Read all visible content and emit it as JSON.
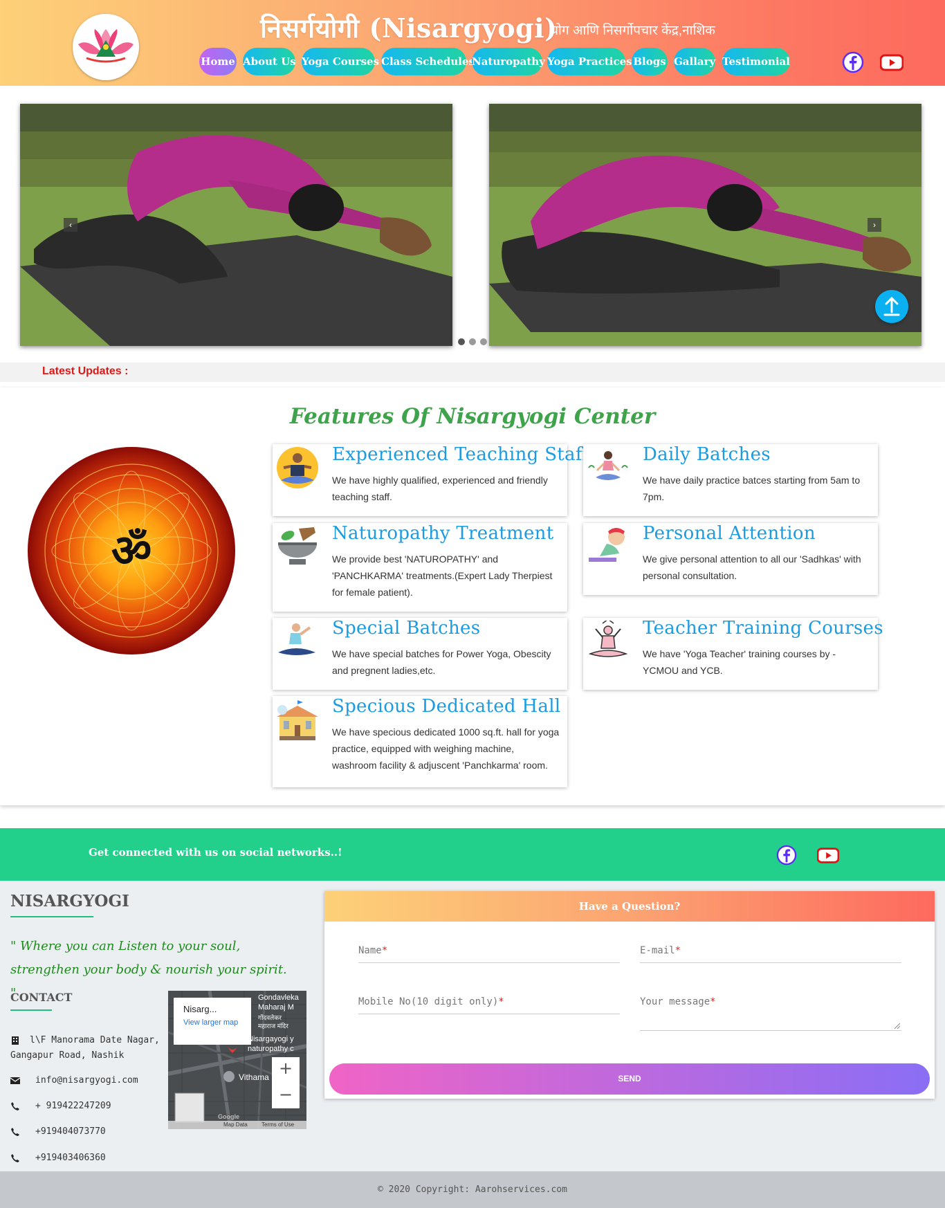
{
  "header": {
    "site_title": "निसर्गयोगी (Nisargyogi)",
    "site_subtitle": "योग आणि निसर्गोपचार केंद्र,नाशिक",
    "nav": [
      "Home",
      "About Us",
      "Yoga Courses",
      "Class Schedules",
      "Naturopathy",
      "Yoga Practices",
      "Blogs",
      "Gallary",
      "Testimonial"
    ],
    "social": [
      "facebook-icon",
      "youtube-icon"
    ]
  },
  "slider": {
    "prev_arrow": "‹",
    "next_arrow": "›",
    "dots": 3,
    "active_dot": 1
  },
  "updates": {
    "label": "Latest Updates :"
  },
  "features": {
    "title": "Features Of Nisargyogi Center",
    "cards": [
      {
        "title": "Experienced Teaching Staff",
        "text": "We have highly qualified, experienced and friendly teaching staff.",
        "icon": "meditating-man-icon"
      },
      {
        "title": "Daily Batches",
        "text": "We have daily practice batces starting from 5am to 7pm.",
        "icon": "meditating-woman-icon"
      },
      {
        "title": "Naturopathy Treatment",
        "text": "We provide best 'NATUROPATHY' and 'PANCHKARMA' treatments.(Expert Lady Therpiest for female patient).",
        "icon": "mortar-pestle-icon"
      },
      {
        "title": "Personal Attention",
        "text": "We give personal attention to all our 'Sadhkas' with personal consultation.",
        "icon": "cobra-pose-icon"
      },
      {
        "title": "Special Batches",
        "text": "We have special batches for Power Yoga, Obescity and pregnent ladies,etc.",
        "icon": "yoga-pose-icon"
      },
      {
        "title": "Teacher Training Courses",
        "text": "We have 'Yoga Teacher' training courses by - YCMOU and YCB.",
        "icon": "lotus-pose-icon"
      },
      {
        "title": "Specious Dedicated Hall",
        "text": "We have specious dedicated 1000 sq.ft. hall for yoga practice, equipped with weighing machine, washroom facility & adjuscent 'Panchkarma' room.",
        "icon": "building-icon"
      }
    ]
  },
  "social_bar": {
    "text": "Get connected with us on social networks..!"
  },
  "footer": {
    "brand": "NISARGYOGI",
    "tagline": "\" Where you can Listen to your soul, strengthen your body & nourish your spirit. \"",
    "contact_heading": "CONTACT",
    "contacts": [
      {
        "icon": "building-icon",
        "text": "l\\F Manorama Date Nagar,",
        "text2": "Gangapur Road, Nashik"
      },
      {
        "icon": "envelope-icon",
        "text": "info@nisargyogi.com"
      },
      {
        "icon": "phone-icon",
        "text": "+ 919422247209"
      },
      {
        "icon": "phone-icon",
        "text": "+919404073770"
      },
      {
        "icon": "phone-icon",
        "text": "+919403406360"
      }
    ],
    "map": {
      "place": "Nisarg...",
      "link": "View larger map",
      "label1": "Gondavleka",
      "label2": "Maharaj M",
      "label3": "गोंदवलेकर",
      "label4": "महाराज मंदिर",
      "label5": "Nisargayogi y",
      "label6": "naturopathy c",
      "label7": "Vithama",
      "label8": "Map Data",
      "label9": "Terms of Use",
      "label10": "Google"
    }
  },
  "form": {
    "heading": "Have a Question?",
    "name": "Name",
    "email": "E-mail",
    "mobile": "Mobile No(10 digit only)",
    "message": "Your message",
    "required": "*",
    "send": "SEND"
  },
  "copyright": "© 2020 Copyright: Aarohservices.com",
  "colors": {
    "green": "#22d08c",
    "blue": "#1d9be0",
    "red": "#e01818"
  }
}
